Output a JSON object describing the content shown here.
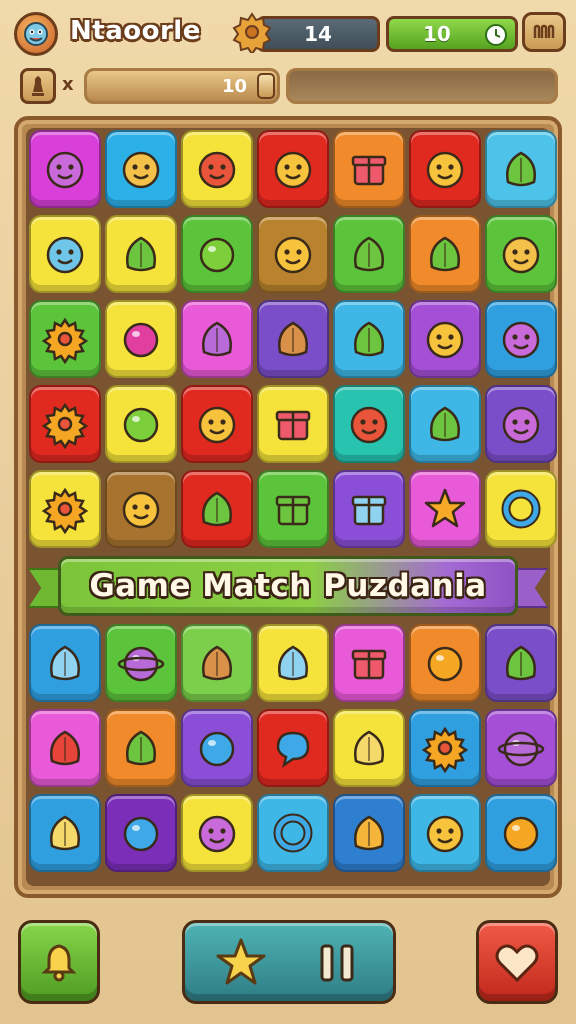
{
  "header": {
    "title": "Ntaoorle",
    "coins": "14",
    "timer": "10"
  },
  "subbar": {
    "multiplier": "x",
    "slider_value": "10",
    "slider_level": 1.0
  },
  "banner": {
    "text": "Game Match Puzdania"
  },
  "board": {
    "columns": 7,
    "top_rows": [
      [
        [
          "#d93fd9",
          "blob-face-icon"
        ],
        [
          "#2bb0e8",
          "monster-face-icon"
        ],
        [
          "#f5e23a",
          "red-face-icon"
        ],
        [
          "#e0291f",
          "smiley-icon"
        ],
        [
          "#f08a2a",
          "gift-box-icon"
        ],
        [
          "#e0291f",
          "drop-face-icon"
        ],
        [
          "#4ec3ea",
          "plant-pot-icon"
        ]
      ],
      [
        [
          "#f5e23a",
          "skull-face-icon"
        ],
        [
          "#f5e23a",
          "bush-bowl-icon"
        ],
        [
          "#5cc43a",
          "lemon-icon"
        ],
        [
          "#b9822f",
          "smiley-icon"
        ],
        [
          "#5cc43a",
          "jelly-icon"
        ],
        [
          "#f08a2a",
          "leaf-jelly-icon"
        ],
        [
          "#5cc43a",
          "square-face-icon"
        ]
      ],
      [
        [
          "#5cc43a",
          "gear-flower-icon"
        ],
        [
          "#f5e23a",
          "berry-icon"
        ],
        [
          "#e95ad8",
          "virus-icon"
        ],
        [
          "#7b4ec9",
          "cupcake-icon"
        ],
        [
          "#3fb7e6",
          "bottle-icon"
        ],
        [
          "#a44fd6",
          "girl-face-icon"
        ],
        [
          "#2f9fe0",
          "pink-square-face-icon"
        ]
      ],
      [
        [
          "#e0291f",
          "sun-gear-icon"
        ],
        [
          "#f5e23a",
          "lime-icon"
        ],
        [
          "#e0291f",
          "boy-face-icon"
        ],
        [
          "#f5e23a",
          "gift-box-icon"
        ],
        [
          "#28c4b0",
          "bald-face-icon"
        ],
        [
          "#3fb7e6",
          "leaf-icon"
        ],
        [
          "#7b4ec9",
          "bell-face-icon"
        ]
      ],
      [
        [
          "#f5e23a",
          "gear-icon"
        ],
        [
          "#a8722f",
          "cookie-face-icon"
        ],
        [
          "#e0291f",
          "leaf-icon"
        ],
        [
          "#5cc43a",
          "green-box-icon"
        ],
        [
          "#8a4fd6",
          "ice-cube-icon"
        ],
        [
          "#e95ad8",
          "star-icon"
        ],
        [
          "#f5e23a",
          "ring-icon"
        ]
      ]
    ],
    "bottom_rows": [
      [
        [
          "#2f9fe0",
          "slingshot-icon"
        ],
        [
          "#5cc43a",
          "planet-icon"
        ],
        [
          "#7ccf4a",
          "bread-icon"
        ],
        [
          "#f5e23a",
          "crossed-tools-icon"
        ],
        [
          "#e95ad8",
          "gift-box-icon"
        ],
        [
          "#f08a2a",
          "orange-icon"
        ],
        [
          "#7b4ec9",
          "jelly-icon"
        ]
      ],
      [
        [
          "#e95ad8",
          "shell-icon"
        ],
        [
          "#f08a2a",
          "swirl-icon"
        ],
        [
          "#8a4fd6",
          "blue-orb-icon"
        ],
        [
          "#e0291f",
          "speech-bubble-icon"
        ],
        [
          "#f5e23a",
          "pencil-icon"
        ],
        [
          "#2f9fe0",
          "sun-gear-icon"
        ],
        [
          "#a44fd6",
          "planet-icon"
        ]
      ],
      [
        [
          "#2f9fe0",
          "chalk-icon"
        ],
        [
          "#7b2fb8",
          "water-drop-icon"
        ],
        [
          "#f5e23a",
          "purple-blob-face-icon"
        ],
        [
          "#3fb7e6",
          "ring-button-icon"
        ],
        [
          "#2f7fd0",
          "crystal-icon"
        ],
        [
          "#3fb7e6",
          "smiley-drop-icon"
        ],
        [
          "#2f9fe0",
          "orange-drop-icon"
        ]
      ]
    ]
  },
  "footer": {
    "left_icon": "bell-icon",
    "mid_left_icon": "star-icon",
    "mid_right_icon": "pause-icon",
    "right_icon": "heart-icon"
  }
}
